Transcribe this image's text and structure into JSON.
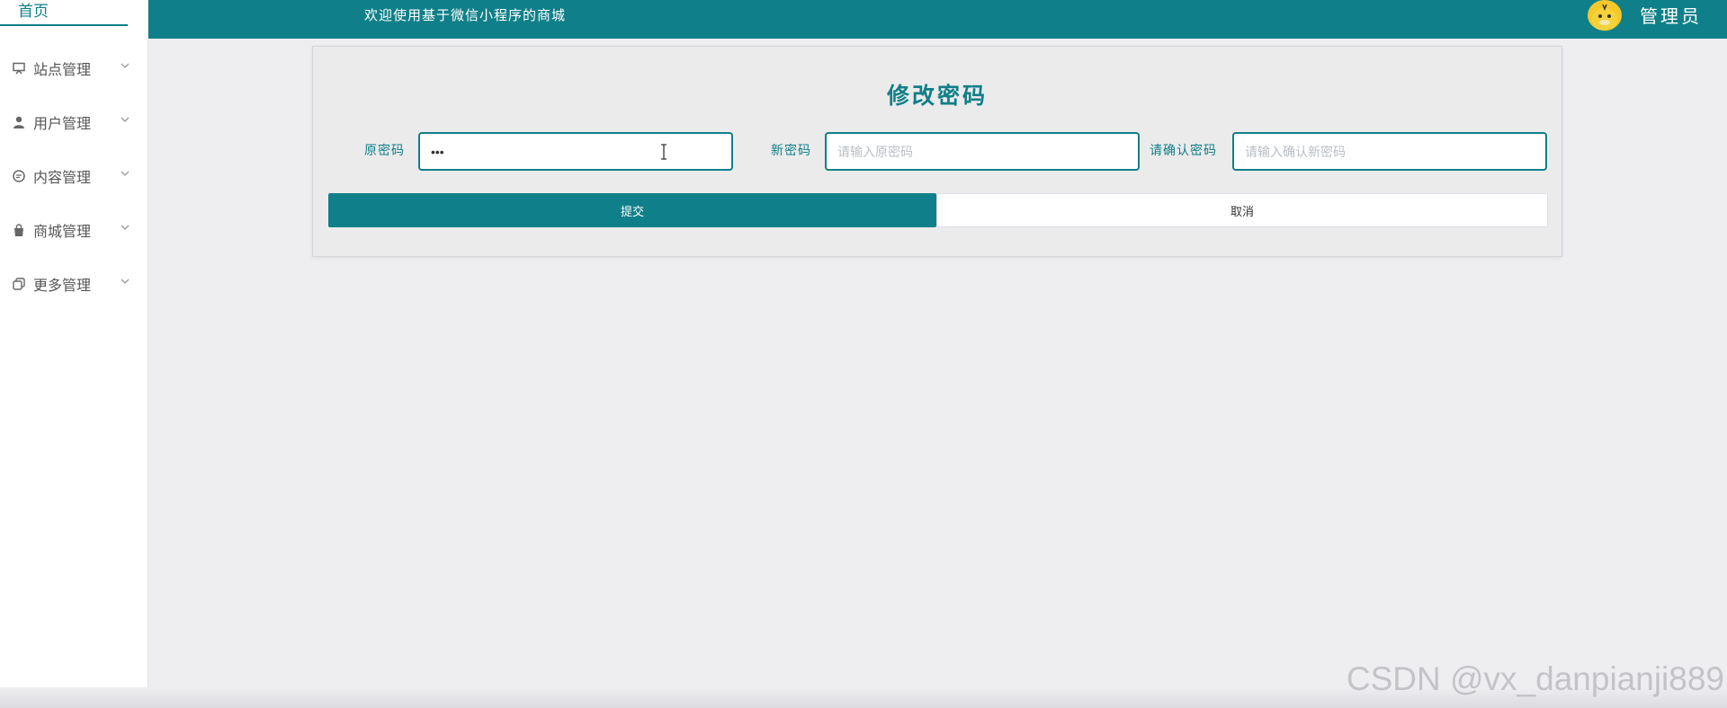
{
  "sidebar": {
    "home": "首页",
    "items": [
      {
        "label": "站点管理",
        "icon": "monitor-icon"
      },
      {
        "label": "用户管理",
        "icon": "user-icon"
      },
      {
        "label": "内容管理",
        "icon": "chat-icon"
      },
      {
        "label": "商城管理",
        "icon": "shopping-bag-icon"
      },
      {
        "label": "更多管理",
        "icon": "copy-icon"
      }
    ]
  },
  "header": {
    "welcome": "欢迎使用基于微信小程序的商城",
    "user_name": "管理员"
  },
  "form": {
    "title": "修改密码",
    "old_password": {
      "label": "原密码",
      "value": "•••",
      "placeholder": ""
    },
    "new_password": {
      "label": "新密码",
      "value": "",
      "placeholder": "请输入原密码"
    },
    "confirm_password": {
      "label": "请确认密码",
      "value": "",
      "placeholder": "请输入确认新密码"
    },
    "submit_label": "提交",
    "cancel_label": "取消"
  },
  "watermark": "CSDN @vx_danpianji889",
  "colors": {
    "accent": "#0f8089",
    "background": "#eeeef1"
  }
}
